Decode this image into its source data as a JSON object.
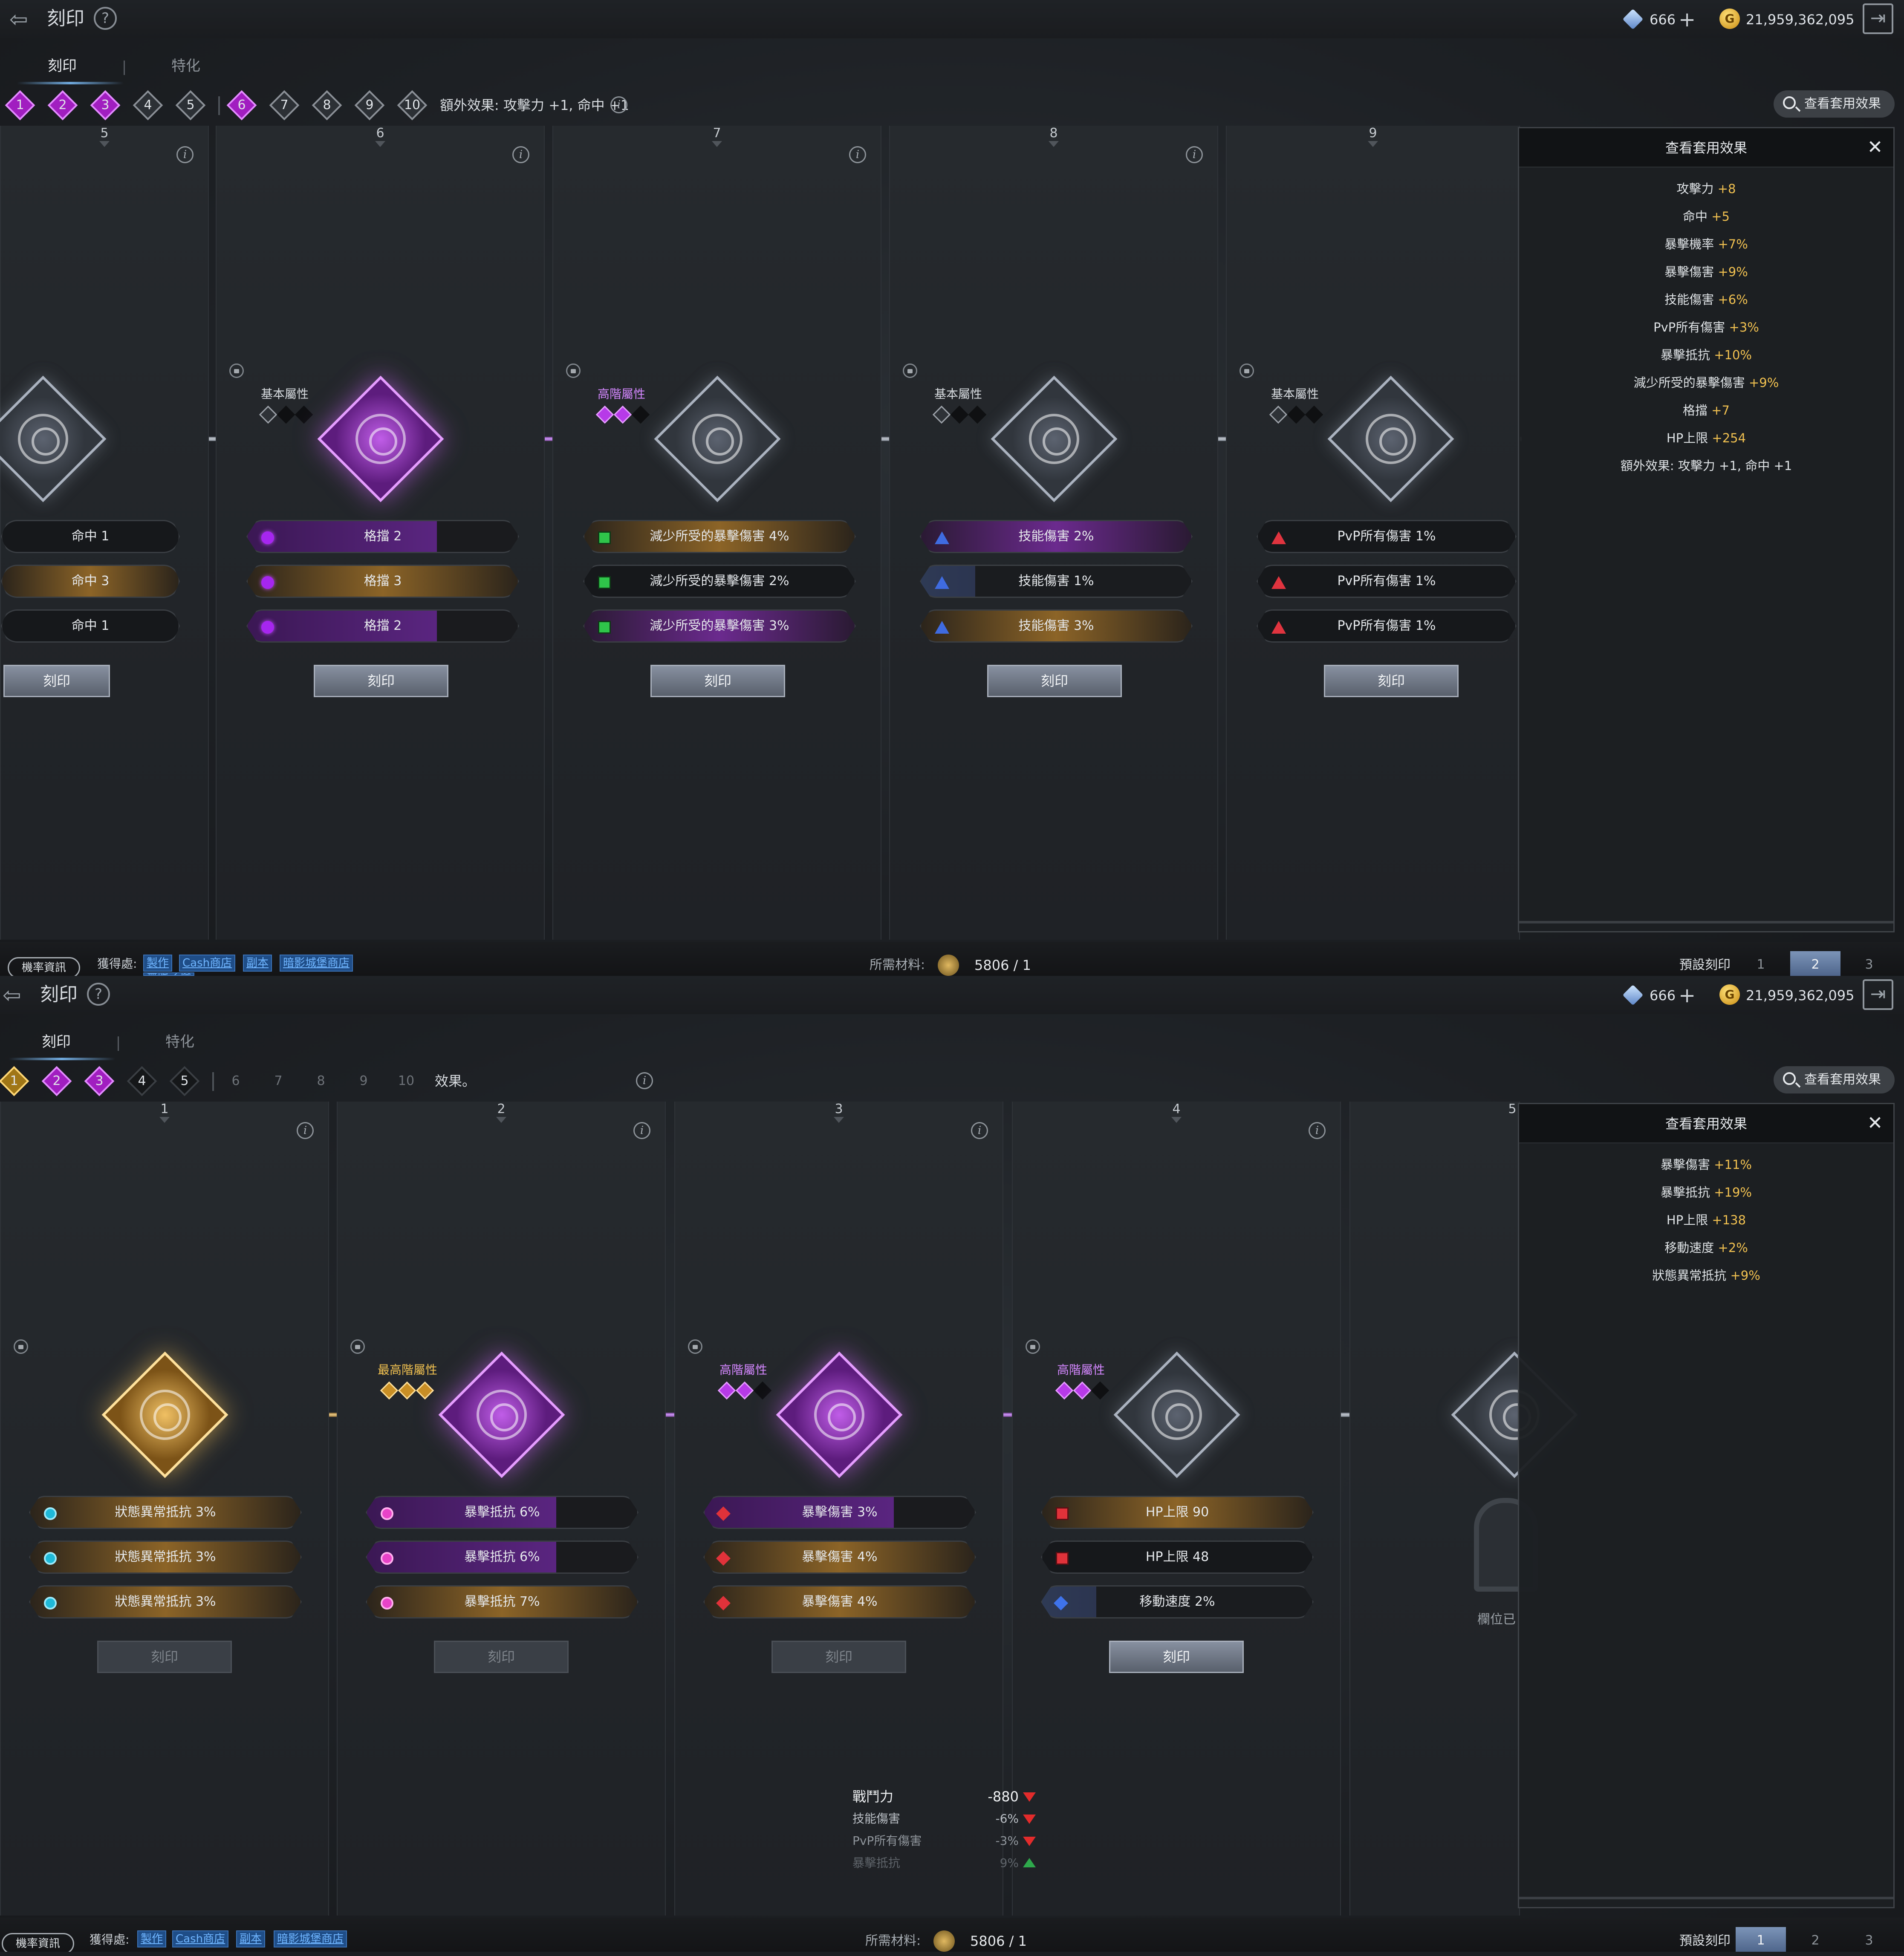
{
  "colors": {
    "purple": "#a11ec0",
    "gold": "#a07616",
    "link": "#6fb5ff",
    "value": "#f0c050",
    "down": "#e22b2b",
    "up": "#2ea84b"
  },
  "screens": [
    {
      "title": "刻印",
      "gems": "666",
      "gold": "21,959,362,095",
      "coin_icon": "G",
      "tabs": [
        "刻印",
        "特化"
      ],
      "steps": [
        "1",
        "2",
        "3",
        "4",
        "5",
        "6",
        "7",
        "8",
        "9",
        "10"
      ],
      "extra": "額外效果: 攻擊力 +1, 命中 +1",
      "view_button": "查看套用效果",
      "columns": [
        {
          "num": "5",
          "grade": "",
          "stats": [
            "命中 1",
            "命中 3",
            "命中 1"
          ],
          "button": "刻印"
        },
        {
          "num": "6",
          "grade": "基本屬性",
          "stats": [
            "格擋 2",
            "格擋 3",
            "格擋 2"
          ],
          "button": "刻印"
        },
        {
          "num": "7",
          "grade": "高階屬性",
          "stats": [
            "減少所受的暴擊傷害 4%",
            "減少所受的暴擊傷害 2%",
            "減少所受的暴擊傷害 3%"
          ],
          "button": "刻印"
        },
        {
          "num": "8",
          "grade": "基本屬性",
          "stats": [
            "技能傷害 2%",
            "技能傷害 1%",
            "技能傷害 3%"
          ],
          "button": "刻印"
        },
        {
          "num": "9",
          "grade": "基本屬性",
          "stats": [
            "PvP所有傷害 1%",
            "PvP所有傷害 1%",
            "PvP所有傷害 1%"
          ],
          "button": "刻印"
        }
      ],
      "panel": {
        "title": "查看套用效果",
        "lines": [
          {
            "k": "攻擊力",
            "v": "+8"
          },
          {
            "k": "命中",
            "v": "+5"
          },
          {
            "k": "暴擊機率",
            "v": "+7%"
          },
          {
            "k": "暴擊傷害",
            "v": "+9%"
          },
          {
            "k": "技能傷害",
            "v": "+6%"
          },
          {
            "k": "PvP所有傷害",
            "v": "+3%"
          },
          {
            "k": "暴擊抵抗",
            "v": "+10%"
          },
          {
            "k": "減少所受的暴擊傷害",
            "v": "+9%"
          },
          {
            "k": "格擋",
            "v": "+7"
          },
          {
            "k": "HP上限",
            "v": "+254"
          },
          {
            "k": "額外效果: 攻擊力 +1, 命中 +1",
            "v": ""
          }
        ]
      },
      "bottom": {
        "rate_info": "機率資訊",
        "source_label": "獲得處:",
        "sources": [
          "製作",
          "Cash商店",
          "副本",
          "暗影城堡商店"
        ],
        "source_extra": "無限之塔",
        "material_label": "所需材料:",
        "material_value": "5806 / 1",
        "preset_label": "預設刻印",
        "presets": [
          "1",
          "2",
          "3"
        ]
      }
    },
    {
      "title": "刻印",
      "gems": "666",
      "gold": "21,959,362,095",
      "coin_icon": "G",
      "tabs": [
        "刻印",
        "特化"
      ],
      "steps": [
        "1",
        "2",
        "3",
        "4",
        "5",
        "6",
        "7",
        "8",
        "9",
        "10"
      ],
      "extra": "效果。",
      "view_button": "查看套用效果",
      "columns": [
        {
          "num": "1",
          "grade": "",
          "stats": [
            "狀態異常抵抗 3%",
            "狀態異常抵抗 3%",
            "狀態異常抵抗 3%"
          ],
          "button": "刻印"
        },
        {
          "num": "2",
          "grade": "最高階屬性",
          "stats": [
            "暴擊抵抗 6%",
            "暴擊抵抗 6%",
            "暴擊抵抗 7%"
          ],
          "button": "刻印"
        },
        {
          "num": "3",
          "grade": "高階屬性",
          "stats": [
            "暴擊傷害 3%",
            "暴擊傷害 4%",
            "暴擊傷害 4%"
          ],
          "button": "刻印"
        },
        {
          "num": "4",
          "grade": "高階屬性",
          "stats": [
            "HP上限 90",
            "HP上限 48",
            "移動速度 2%"
          ],
          "button": "刻印"
        },
        {
          "num": "5",
          "grade": "",
          "stats": [],
          "button": ""
        }
      ],
      "sealed_text": "欄位已",
      "panel": {
        "title": "查看套用效果",
        "lines": [
          {
            "k": "暴擊傷害",
            "v": "+11%"
          },
          {
            "k": "暴擊抵抗",
            "v": "+19%"
          },
          {
            "k": "HP上限",
            "v": "+138"
          },
          {
            "k": "移動速度",
            "v": "+2%"
          },
          {
            "k": "狀態異常抵抗",
            "v": "+9%"
          }
        ]
      },
      "combat": [
        {
          "k": "戰鬥力",
          "v": "-880",
          "dir": "down"
        },
        {
          "k": "技能傷害",
          "v": "-6%",
          "dir": "down"
        },
        {
          "k": "PvP所有傷害",
          "v": "-3%",
          "dir": "down"
        },
        {
          "k": "暴擊抵抗",
          "v": "9%",
          "dir": "up"
        }
      ],
      "bottom": {
        "rate_info": "機率資訊",
        "source_label": "獲得處:",
        "sources": [
          "製作",
          "Cash商店",
          "副本",
          "暗影城堡商店"
        ],
        "source_extra": "",
        "material_label": "所需材料:",
        "material_value": "5806 / 1",
        "preset_label": "預設刻印",
        "presets": [
          "1",
          "2",
          "3"
        ]
      }
    }
  ]
}
